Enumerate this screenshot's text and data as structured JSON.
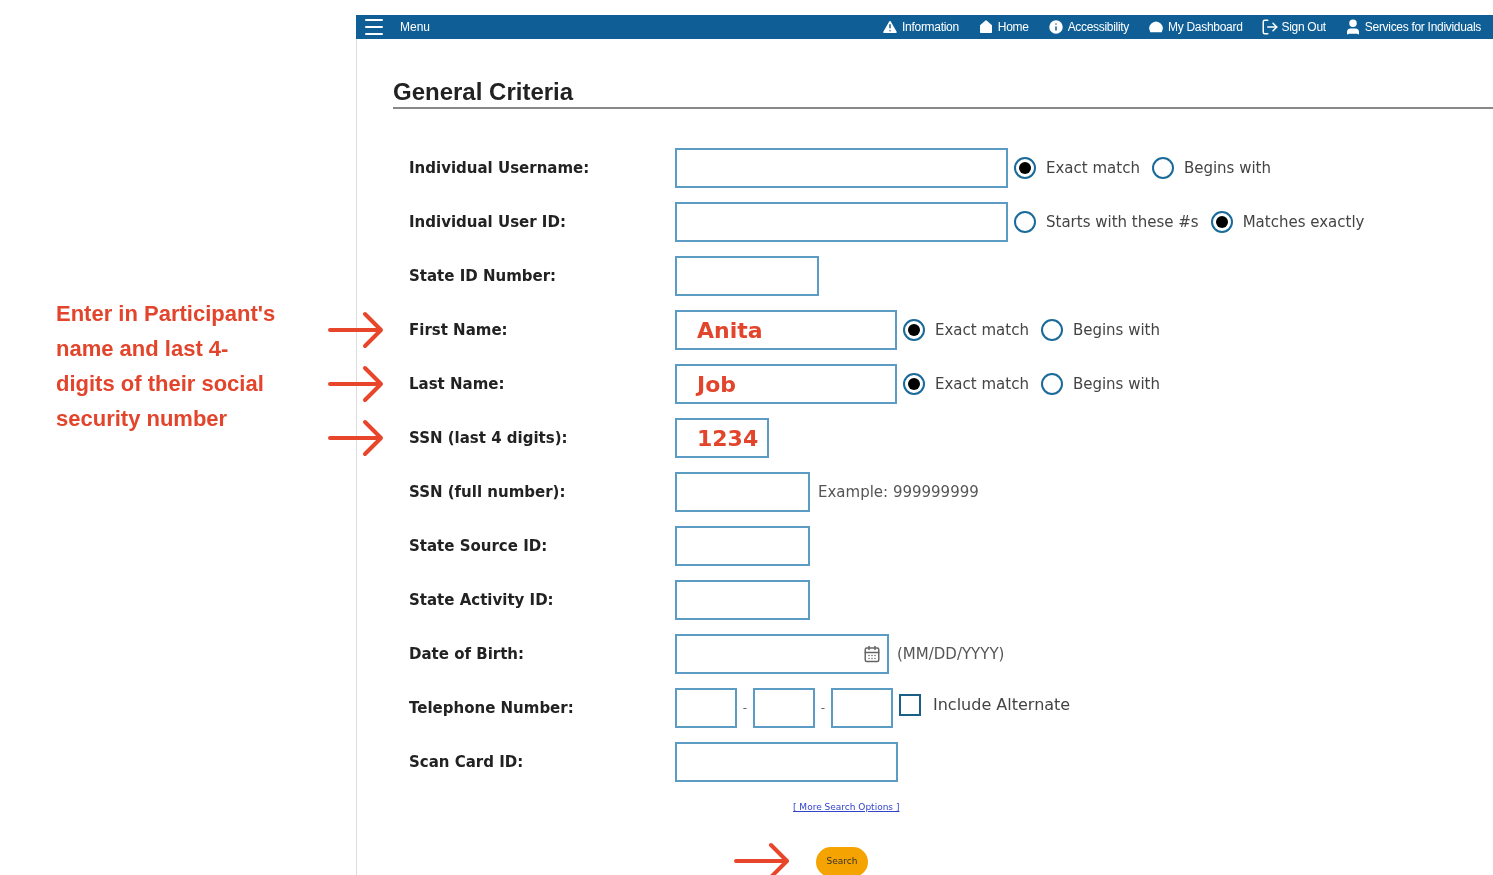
{
  "nav": {
    "menu": "Menu",
    "items": [
      {
        "label": "Information"
      },
      {
        "label": "Home"
      },
      {
        "label": "Accessibility"
      },
      {
        "label": "My Dashboard"
      },
      {
        "label": "Sign Out"
      },
      {
        "label": "Services for Individuals"
      }
    ]
  },
  "annotation": "Enter in Participant's name and last 4-digits of their social security number",
  "title": "General Criteria",
  "rows": [
    {
      "label": "Individual Username:",
      "kind": "text",
      "options": [
        {
          "label": "Exact match",
          "selected": true
        },
        {
          "label": "Begins with",
          "selected": false
        }
      ]
    },
    {
      "label": "Individual User ID:",
      "kind": "text",
      "options": [
        {
          "label": "Starts with these #s",
          "selected": false
        },
        {
          "label": "Matches exactly",
          "selected": true
        }
      ]
    },
    {
      "label": "State ID Number:",
      "kind": "text"
    },
    {
      "label": "First Name:",
      "kind": "text",
      "value": "Anita",
      "pointed": true,
      "options": [
        {
          "label": "Exact match",
          "selected": true
        },
        {
          "label": "Begins with",
          "selected": false
        }
      ]
    },
    {
      "label": "Last Name:",
      "kind": "text",
      "value": "Job",
      "pointed": true,
      "options": [
        {
          "label": "Exact match",
          "selected": true
        },
        {
          "label": "Begins with",
          "selected": false
        }
      ]
    },
    {
      "label": "SSN (last 4 digits):",
      "kind": "text",
      "value": "1234",
      "pointed": true
    },
    {
      "label": "SSN (full number):",
      "kind": "text",
      "hint": "Example: 999999999"
    },
    {
      "label": "State Source ID:",
      "kind": "text"
    },
    {
      "label": "State Activity ID:",
      "kind": "text"
    },
    {
      "label": "Date of Birth:",
      "kind": "date",
      "hint": "(MM/DD/YYYY)"
    },
    {
      "label": "Telephone Number:",
      "kind": "phone",
      "separators": [
        "-",
        "-"
      ],
      "checkbox": {
        "label": "Include Alternate",
        "checked": false
      }
    },
    {
      "label": "Scan Card ID:",
      "kind": "text"
    }
  ],
  "more_link": "[ More Search Options ]",
  "search": {
    "label": "Search",
    "pointed": true
  }
}
